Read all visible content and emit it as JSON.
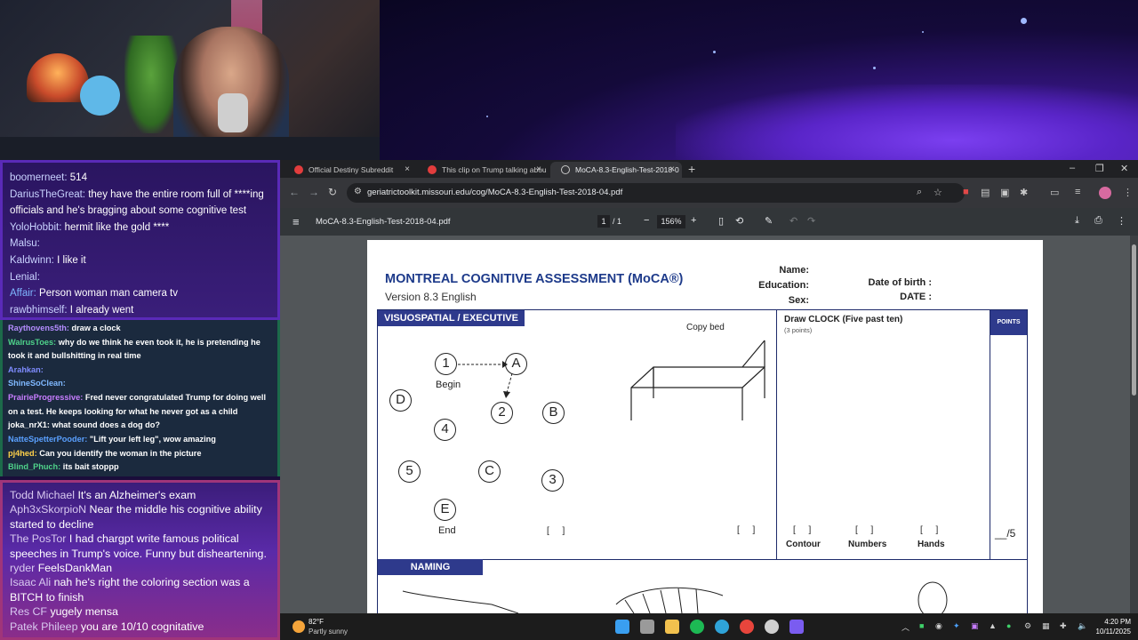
{
  "chat": {
    "top": [
      {
        "user": "boomerneet:",
        "text": "514",
        "user_color": "#c9d3ff"
      },
      {
        "user": "DariusTheGreat:",
        "text": "they have the entire room full of ****ing",
        "user_color": "#c9d3ff"
      },
      {
        "user": "",
        "text": "officials and he's bragging about some cognitive test",
        "user_color": "#ffffff"
      },
      {
        "user": "YoloHobbit:",
        "text": "hermit  like the gold ****",
        "user_color": "#c9d3ff"
      },
      {
        "user": "Malsu:",
        "text": "",
        "user_color": "#c9d3ff"
      },
      {
        "user": "Kaldwinn:",
        "text": "I like it",
        "user_color": "#c9d3ff"
      },
      {
        "user": "Lenial:",
        "text": "",
        "user_color": "#c9d3ff"
      },
      {
        "user": "Affair:",
        "text": "Person woman man camera tv",
        "user_color": "#7fb8ff"
      },
      {
        "user": "rawbhimself:",
        "text": "I already went",
        "user_color": "#c9d3ff"
      }
    ],
    "middle": [
      {
        "user": "Raythovens5th:",
        "text": "draw a clock",
        "user_color": "#b48cff",
        "wrap": false
      },
      {
        "user": "WalrusToes:",
        "text": "why do we think he even took it, he is pretending he took it and bullshitting in real time",
        "user_color": "#4fd38a",
        "wrap": true
      },
      {
        "user": "Arahkan:",
        "text": "",
        "user_color": "#7f8cff",
        "wrap": false
      },
      {
        "user": "ShineSoClean:",
        "text": "",
        "user_color": "#7fb8ff",
        "wrap": false
      },
      {
        "user": "PrairieProgressive:",
        "text": "Fred never congratulated Trump for doing well on a test. He keeps looking for what he never got as a child",
        "user_color": "#c77dff",
        "wrap": true
      },
      {
        "user": "joka_nrX1:",
        "text": "what sound does a dog do?",
        "user_color": "#ffffff",
        "wrap": false
      },
      {
        "user": "NatteSpetterPooder:",
        "text": "\"Lift your left leg\",  wow amazing",
        "user_color": "#5aa0ff",
        "wrap": false
      },
      {
        "user": "pj4hed:",
        "text": "Can you identify the woman in the picture",
        "user_color": "#ffd24a",
        "wrap": false
      },
      {
        "user": "Blind_Phuch:",
        "text": "its bait stoppp",
        "user_color": "#4fd38a",
        "wrap": false
      }
    ],
    "bottom": [
      {
        "user": "Todd Michael",
        "text": "It's an Alzheimer's exam"
      },
      {
        "user": "Aph3xSkorpioN",
        "text": "Near the middle his cognitive ability started to decline"
      },
      {
        "user": "The PosTor",
        "text": "I had chargpt write famous political speeches in Trump's voice. Funny but disheartening."
      },
      {
        "user": "ryder",
        "text": "FeelsDankMan"
      },
      {
        "user": "Isaac Ali",
        "text": "nah he's right the coloring section was a BITCH to finish"
      },
      {
        "user": "Res CF",
        "text": "yugely mensa"
      },
      {
        "user": "Patek Phileep",
        "text": "you are 10/10 cognitative"
      }
    ]
  },
  "browser": {
    "tabs": [
      {
        "label": "Official Destiny Subreddit",
        "active": false
      },
      {
        "label": "This clip on Trump talking abou",
        "active": false
      },
      {
        "label": "MoCA-8.3-English-Test-2018-0",
        "active": true
      }
    ],
    "url": "geriatrictoolkit.missouri.edu/cog/MoCA-8.3-English-Test-2018-04.pdf",
    "pdf": {
      "filename": "MoCA-8.3-English-Test-2018-04.pdf",
      "page_current": "1",
      "page_total": "1",
      "zoom": "156%"
    }
  },
  "moca": {
    "title": "MONTREAL COGNITIVE ASSESSMENT (MoCA®)",
    "version": "Version 8.3 English",
    "name_label": "Name:",
    "education_label": "Education:",
    "sex_label": "Sex:",
    "dob_label": "Date of birth :",
    "date_label": "DATE :",
    "visuospatial_header": "VISUOSPATIAL / EXECUTIVE",
    "copy_bed": "Copy bed",
    "draw_clock": "Draw CLOCK (Five past ten)",
    "clock_points": "(3 points)",
    "points_header": "POINTS",
    "trail_nodes": [
      "1",
      "A",
      "2",
      "B",
      "D",
      "4",
      "5",
      "C",
      "3",
      "E"
    ],
    "begin": "Begin",
    "end": "End",
    "bracket": "[  ]",
    "contour": "Contour",
    "numbers": "Numbers",
    "hands": "Hands",
    "score": "__/5",
    "naming_header": "NAMING"
  },
  "taskbar": {
    "temp": "82°F",
    "condition": "Partly sunny",
    "time": "4:20 PM",
    "date": "10/11/2025"
  },
  "colors": {
    "moca_blue": "#2e3a8c",
    "chrome_dark": "#202124",
    "chrome_toolbar": "#35363a",
    "pdf_bar": "#323639"
  }
}
